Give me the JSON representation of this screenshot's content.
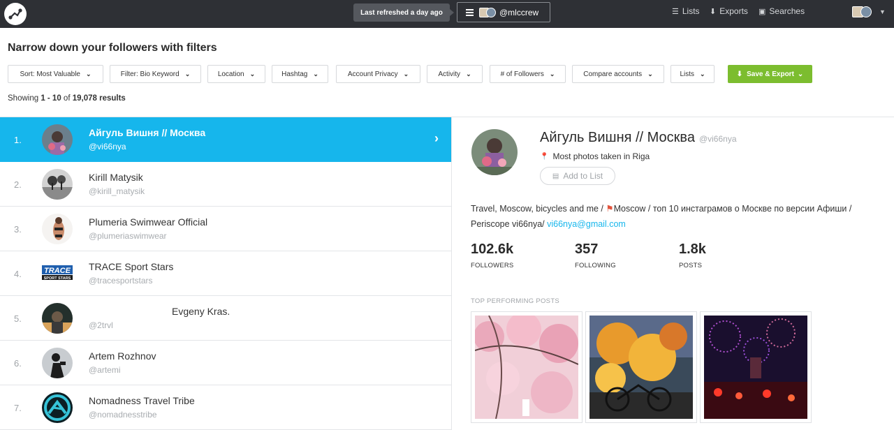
{
  "topbar": {
    "refresh": "Last refreshed a day ago",
    "account_handle": "@mlccrew",
    "nav": [
      {
        "label": "Lists",
        "icon": "list-icon"
      },
      {
        "label": "Exports",
        "icon": "download-icon"
      },
      {
        "label": "Searches",
        "icon": "save-icon"
      }
    ]
  },
  "page_title": "Narrow down your followers with filters",
  "filters": [
    "Sort: Most Valuable",
    "Filter: Bio Keyword",
    "Location",
    "Hashtag",
    "Account Privacy",
    "Activity",
    "# of Followers",
    "Compare accounts",
    "Lists"
  ],
  "save_export": "Save & Export",
  "results": {
    "prefix": "Showing ",
    "range": "1 - 10",
    "of": " of ",
    "total": "19,078 results"
  },
  "followers": [
    {
      "rank": "1.",
      "name": "Айгуль Вишня // Москва",
      "handle": "@vi66nya",
      "selected": true
    },
    {
      "rank": "2.",
      "name": "Kirill Matysik",
      "handle": "@kirill_matysik"
    },
    {
      "rank": "3.",
      "name": "Plumeria Swimwear Official",
      "handle": "@plumeriaswimwear"
    },
    {
      "rank": "4.",
      "name": "TRACE Sport Stars",
      "handle": "@tracesportstars"
    },
    {
      "rank": "5.",
      "name": "Evgeny Kras.",
      "handle": "@2trvl"
    },
    {
      "rank": "6.",
      "name": "Artem Rozhnov",
      "handle": "@artemi"
    },
    {
      "rank": "7.",
      "name": "Nomadness Travel Tribe",
      "handle": "@nomadnesstribe"
    }
  ],
  "trace_logo": {
    "line1": "TRACE",
    "line2": "SPORT STARS"
  },
  "detail": {
    "name": "Айгуль Вишня // Москва",
    "handle": "@vi66nya",
    "location": "Most photos taken in Riga",
    "add_to_list": "Add to List",
    "bio_part1": "Travel, Moscow, bicycles and me / ",
    "bio_flag": "⚑",
    "bio_part2": "Moscow / топ 10 инстаграмов о Москве по версии Афиши / Periscope vi66nya/ ",
    "bio_email": "vi66nya@gmail.com",
    "stats": [
      {
        "value": "102.6k",
        "label": "FOLLOWERS"
      },
      {
        "value": "357",
        "label": "FOLLOWING"
      },
      {
        "value": "1.8k",
        "label": "POSTS"
      }
    ],
    "top_posts_label": "TOP PERFORMING POSTS"
  },
  "colors": {
    "accent": "#16b6ec",
    "topbar": "#2e3035",
    "export_green": "#7cbd2f"
  }
}
